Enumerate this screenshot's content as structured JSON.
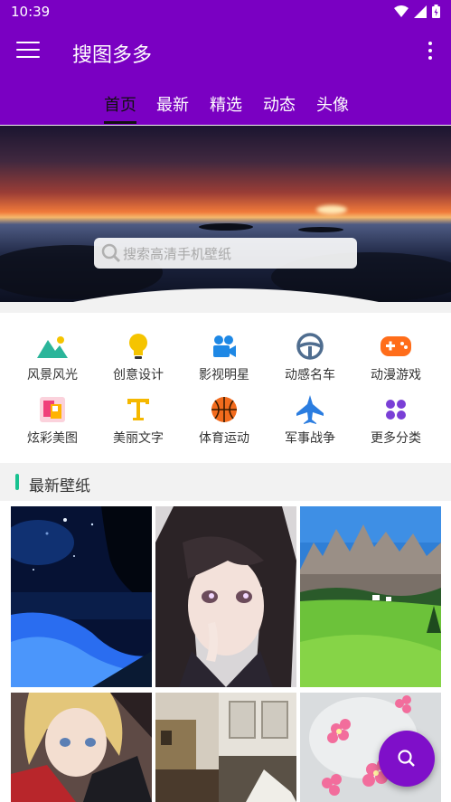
{
  "status": {
    "time": "10:39"
  },
  "app": {
    "title": "搜图多多"
  },
  "tabs": [
    {
      "label": "首页",
      "active": true
    },
    {
      "label": "最新",
      "active": false
    },
    {
      "label": "精选",
      "active": false
    },
    {
      "label": "动态",
      "active": false
    },
    {
      "label": "头像",
      "active": false
    }
  ],
  "search": {
    "placeholder": "搜索高清手机壁纸"
  },
  "categories": [
    {
      "label": "风景风光",
      "icon": "landscape-icon",
      "color": "#2bb59a"
    },
    {
      "label": "创意设计",
      "icon": "lightbulb-icon",
      "color": "#f5c400"
    },
    {
      "label": "影视明星",
      "icon": "movie-camera-icon",
      "color": "#1e88e5"
    },
    {
      "label": "动感名车",
      "icon": "steering-wheel-icon",
      "color": "#4f6d8f"
    },
    {
      "label": "动漫游戏",
      "icon": "gamepad-icon",
      "color": "#ff6d1a"
    },
    {
      "label": "炫彩美图",
      "icon": "color-photo-icon",
      "color": "#f0407a"
    },
    {
      "label": "美丽文字",
      "icon": "text-icon",
      "color": "#f5b800"
    },
    {
      "label": "体育运动",
      "icon": "basketball-icon",
      "color": "#f26b1d"
    },
    {
      "label": "军事战争",
      "icon": "jet-icon",
      "color": "#2b7de0"
    },
    {
      "label": "更多分类",
      "icon": "more-categories-icon",
      "color": "#7a3fd6"
    }
  ],
  "section": {
    "title": "最新壁纸"
  },
  "colors": {
    "primary": "#7a00c2",
    "accent": "#18c290",
    "fab": "#7f0fc9"
  },
  "wallpapers": [
    {
      "name": "wallpaper-night-beach"
    },
    {
      "name": "wallpaper-anime-girl"
    },
    {
      "name": "wallpaper-mountain-meadow"
    },
    {
      "name": "wallpaper-anime-blonde"
    },
    {
      "name": "wallpaper-room-interior"
    },
    {
      "name": "wallpaper-pink-flowers"
    }
  ]
}
